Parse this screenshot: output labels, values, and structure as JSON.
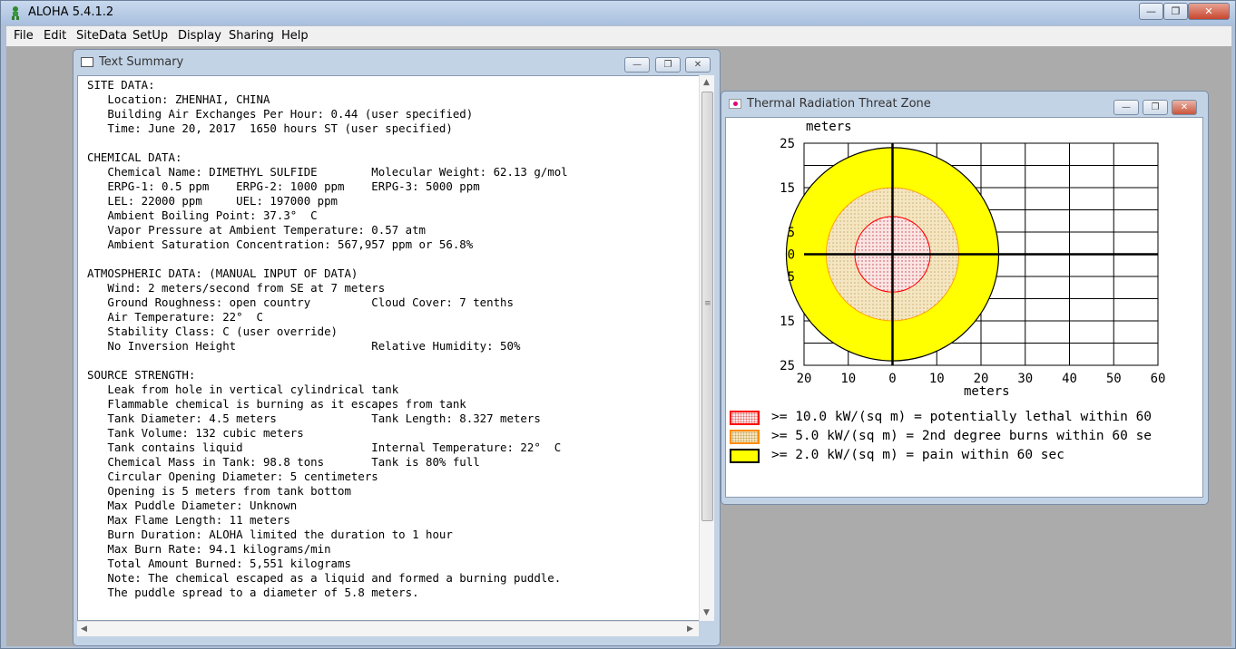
{
  "app": {
    "title": "ALOHA 5.4.1.2",
    "menu": [
      "File",
      "Edit",
      "SiteData",
      "SetUp",
      "Display",
      "Sharing",
      "Help"
    ]
  },
  "text_summary": {
    "title": "Text Summary",
    "lines": [
      "SITE DATA:",
      "   Location: ZHENHAI, CHINA",
      "   Building Air Exchanges Per Hour: 0.44 (user specified)",
      "   Time: June 20, 2017  1650 hours ST (user specified)",
      "",
      "CHEMICAL DATA:",
      "   Chemical Name: DIMETHYL SULFIDE        Molecular Weight: 62.13 g/mol",
      "   ERPG-1: 0.5 ppm    ERPG-2: 1000 ppm    ERPG-3: 5000 ppm",
      "   LEL: 22000 ppm     UEL: 197000 ppm",
      "   Ambient Boiling Point: 37.3°  C",
      "   Vapor Pressure at Ambient Temperature: 0.57 atm",
      "   Ambient Saturation Concentration: 567,957 ppm or 56.8%",
      "",
      "ATMOSPHERIC DATA: (MANUAL INPUT OF DATA)",
      "   Wind: 2 meters/second from SE at 7 meters",
      "   Ground Roughness: open country         Cloud Cover: 7 tenths",
      "   Air Temperature: 22°  C",
      "   Stability Class: C (user override)",
      "   No Inversion Height                    Relative Humidity: 50%",
      "",
      "SOURCE STRENGTH:",
      "   Leak from hole in vertical cylindrical tank",
      "   Flammable chemical is burning as it escapes from tank",
      "   Tank Diameter: 4.5 meters              Tank Length: 8.327 meters",
      "   Tank Volume: 132 cubic meters",
      "   Tank contains liquid                   Internal Temperature: 22°  C",
      "   Chemical Mass in Tank: 98.8 tons       Tank is 80% full",
      "   Circular Opening Diameter: 5 centimeters",
      "   Opening is 5 meters from tank bottom",
      "   Max Puddle Diameter: Unknown",
      "   Max Flame Length: 11 meters",
      "   Burn Duration: ALOHA limited the duration to 1 hour",
      "   Max Burn Rate: 94.1 kilograms/min",
      "   Total Amount Burned: 5,551 kilograms",
      "   Note: The chemical escaped as a liquid and formed a burning puddle.",
      "   The puddle spread to a diameter of 5.8 meters."
    ]
  },
  "threat_zone": {
    "title": "Thermal Radiation Threat Zone",
    "y_axis_label": "meters",
    "x_axis_label": "meters",
    "y_ticks": [
      "25",
      "15",
      "5",
      "0",
      "5",
      "15",
      "25"
    ],
    "x_ticks": [
      "20",
      "10",
      "0",
      "10",
      "20",
      "30",
      "40",
      "50",
      "60"
    ],
    "legend": [
      {
        "text": ">= 10.0 kW/(sq m) = potentially lethal within 60",
        "color": "#ff0000",
        "fill": "#fbe4e4"
      },
      {
        "text": ">= 5.0 kW/(sq m) = 2nd degree burns within 60 se",
        "color": "#ff8c00",
        "fill": "#f5e6c2"
      },
      {
        "text": ">= 2.0 kW/(sq m) = pain within 60 sec",
        "color": "#000000",
        "fill": "#ffff00"
      }
    ]
  },
  "chart_data": {
    "type": "scatter",
    "title": "",
    "xlabel": "meters",
    "ylabel": "meters",
    "xlim": [
      -20,
      60
    ],
    "ylim": [
      -25,
      25
    ],
    "grid": true,
    "zones": [
      {
        "name": ">= 10.0 kW/(sq m) = potentially lethal within 60",
        "radius_m": 8.5,
        "color": "#ff0000"
      },
      {
        "name": ">= 5.0 kW/(sq m) = 2nd degree burns within 60 se",
        "radius_m": 15,
        "color": "#ffa500"
      },
      {
        "name": ">= 2.0 kW/(sq m) = pain within 60 sec",
        "radius_m": 24,
        "color": "#ffff00"
      }
    ],
    "center": [
      0,
      0
    ]
  }
}
